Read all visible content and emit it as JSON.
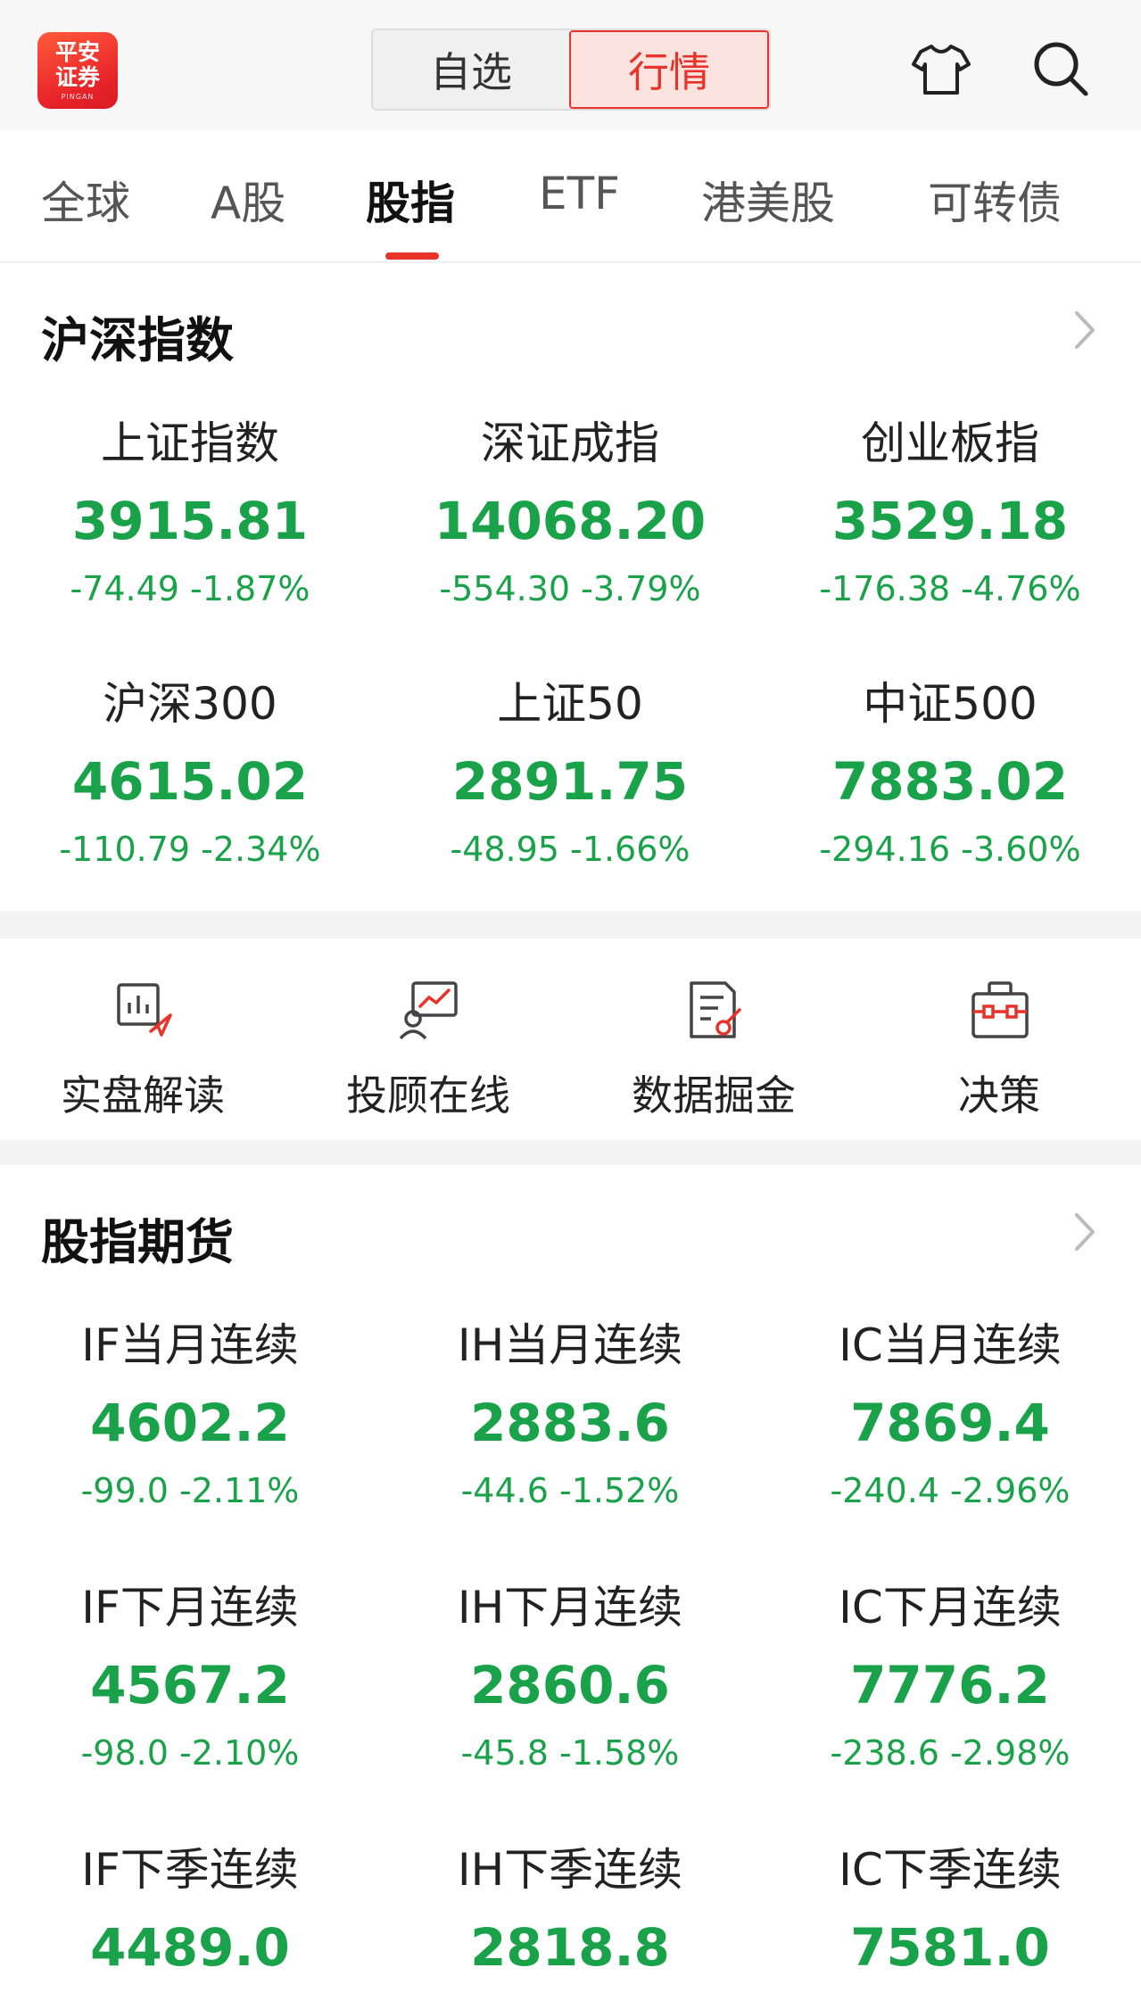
{
  "header": {
    "logo_line1": "平安",
    "logo_line2": "证券",
    "logo_sub": "PINGAN",
    "segments": [
      "自选",
      "行情"
    ],
    "active_segment": "行情",
    "icons": [
      "shirt-icon",
      "search-icon"
    ]
  },
  "tabs": [
    "全球",
    "A股",
    "股指",
    "ETF",
    "港美股",
    "可转债"
  ],
  "active_tab": "股指",
  "colors": {
    "down": "#19a24a",
    "accent": "#e8332a"
  },
  "index_section": {
    "title": "沪深指数",
    "items": [
      {
        "name": "上证指数",
        "value": "3915.81",
        "change": "-74.49 -1.87%"
      },
      {
        "name": "深证成指",
        "value": "14068.20",
        "change": "-554.30 -3.79%"
      },
      {
        "name": "创业板指",
        "value": "3529.18",
        "change": "-176.38 -4.76%"
      },
      {
        "name": "沪深300",
        "value": "4615.02",
        "change": "-110.79 -2.34%"
      },
      {
        "name": "上证50",
        "value": "2891.75",
        "change": "-48.95 -1.66%"
      },
      {
        "name": "中证500",
        "value": "7883.02",
        "change": "-294.16 -3.60%"
      }
    ]
  },
  "quick_menu": [
    {
      "label": "实盘解读",
      "icon": "chart-analysis-icon"
    },
    {
      "label": "投顾在线",
      "icon": "advisor-online-icon"
    },
    {
      "label": "数据掘金",
      "icon": "data-mining-icon"
    },
    {
      "label": "决策",
      "icon": "toolbox-icon"
    }
  ],
  "futures_section": {
    "title": "股指期货",
    "items": [
      {
        "name": "IF当月连续",
        "value": "4602.2",
        "change": "-99.0 -2.11%"
      },
      {
        "name": "IH当月连续",
        "value": "2883.6",
        "change": "-44.6 -1.52%"
      },
      {
        "name": "IC当月连续",
        "value": "7869.4",
        "change": "-240.4 -2.96%"
      },
      {
        "name": "IF下月连续",
        "value": "4567.2",
        "change": "-98.0 -2.10%"
      },
      {
        "name": "IH下月连续",
        "value": "2860.6",
        "change": "-45.8 -1.58%"
      },
      {
        "name": "IC下月连续",
        "value": "7776.2",
        "change": "-238.6 -2.98%"
      },
      {
        "name": "IF下季连续",
        "value": "4489.0"
      },
      {
        "name": "IH下季连续",
        "value": "2818.8"
      },
      {
        "name": "IC下季连续",
        "value": "7581.0"
      }
    ]
  }
}
